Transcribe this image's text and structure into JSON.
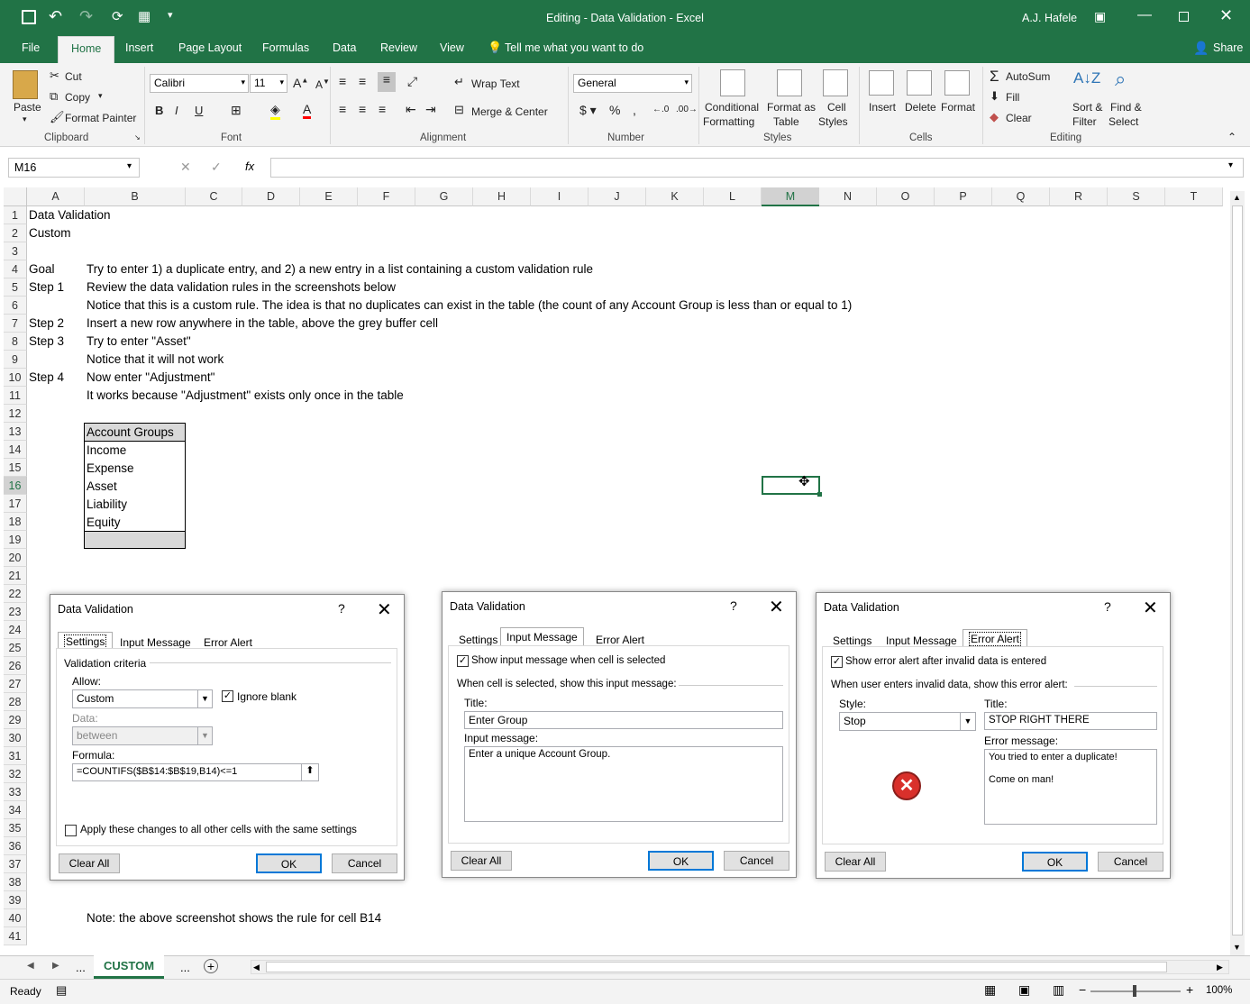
{
  "app": {
    "title": "Editing - Data Validation  -  Excel",
    "user": "A.J. Hafele",
    "accent": "#217346"
  },
  "menu": {
    "tabs": [
      "File",
      "Home",
      "Insert",
      "Page Layout",
      "Formulas",
      "Data",
      "Review",
      "View"
    ],
    "active": "Home",
    "tell_me": "Tell me what you want to do",
    "share": "Share"
  },
  "ribbon": {
    "clipboard": {
      "paste": "Paste",
      "cut": "Cut",
      "copy": "Copy",
      "format_painter": "Format Painter",
      "label": "Clipboard"
    },
    "font": {
      "name": "Calibri",
      "size": "11",
      "label": "Font"
    },
    "alignment": {
      "wrap": "Wrap Text",
      "merge": "Merge & Center",
      "label": "Alignment"
    },
    "number": {
      "format": "General",
      "label": "Number"
    },
    "styles": {
      "cond1": "Conditional",
      "cond2": "Formatting",
      "fmt1": "Format as",
      "fmt2": "Table",
      "cell1": "Cell",
      "cell2": "Styles",
      "label": "Styles"
    },
    "cells": {
      "insert": "Insert",
      "delete": "Delete",
      "format": "Format",
      "label": "Cells"
    },
    "editing": {
      "autosum": "AutoSum",
      "fill": "Fill",
      "clear": "Clear",
      "sort1": "Sort &",
      "sort2": "Filter",
      "find1": "Find &",
      "find2": "Select",
      "label": "Editing"
    }
  },
  "formula_bar": {
    "name_box": "M16",
    "formula": ""
  },
  "columns": [
    "A",
    "B",
    "C",
    "D",
    "E",
    "F",
    "G",
    "H",
    "I",
    "J",
    "K",
    "L",
    "M",
    "N",
    "O",
    "P",
    "Q",
    "R",
    "S",
    "T"
  ],
  "cells": {
    "a1": "Data Validation",
    "a2": "Custom",
    "a4": "Goal",
    "b4": "Try to enter 1) a duplicate entry, and 2) a new entry in a list containing a custom validation rule",
    "a5": "Step 1",
    "b5": "Review the data validation rules in the screenshots below",
    "b6": "Notice that this is a custom rule.  The idea is that no duplicates can exist in the table (the count of any Account Group is less than or equal to 1)",
    "a7": "Step 2",
    "b7": "Insert a new row anywhere in the table, above the grey buffer cell",
    "a8": "Step 3",
    "b8": "Try to enter \"Asset\"",
    "b9": "Notice that it will not work",
    "a10": "Step 4",
    "b10": "Now enter \"Adjustment\"",
    "b11": "It works because \"Adjustment\" exists only once in the table",
    "b40": "Note: the above screenshot shows the rule for cell B14"
  },
  "table": {
    "header": "Account Groups",
    "rows": [
      "Income",
      "Expense",
      "Asset",
      "Liability",
      "Equity"
    ]
  },
  "dialog_settings": {
    "title": "Data Validation",
    "tabs": [
      "Settings",
      "Input Message",
      "Error Alert"
    ],
    "criteria": "Validation criteria",
    "allow_label": "Allow:",
    "allow_value": "Custom",
    "ignore_blank": "Ignore blank",
    "data_label": "Data:",
    "data_value": "between",
    "formula_label": "Formula:",
    "formula_value": "=COUNTIFS($B$14:$B$19,B14)<=1",
    "apply_all": "Apply these changes to all other cells with the same settings",
    "clear": "Clear All",
    "ok": "OK",
    "cancel": "Cancel"
  },
  "dialog_input": {
    "title": "Data Validation",
    "tabs": [
      "Settings",
      "Input Message",
      "Error Alert"
    ],
    "show_msg": "Show input message when cell is selected",
    "when_selected": "When cell is selected, show this input message:",
    "title_label": "Title:",
    "title_value": "Enter Group",
    "msg_label": "Input message:",
    "msg_value": "Enter a unique Account Group.",
    "clear": "Clear All",
    "ok": "OK",
    "cancel": "Cancel"
  },
  "dialog_error": {
    "title": "Data Validation",
    "tabs": [
      "Settings",
      "Input Message",
      "Error Alert"
    ],
    "show_alert": "Show error alert after invalid data is entered",
    "when_invalid": "When user enters invalid data, show this error alert:",
    "style_label": "Style:",
    "style_value": "Stop",
    "title_label": "Title:",
    "title_value": "STOP RIGHT THERE",
    "msg_label": "Error message:",
    "msg_line1": "You tried to enter a duplicate!",
    "msg_line2": "Come on man!",
    "clear": "Clear All",
    "ok": "OK",
    "cancel": "Cancel"
  },
  "sheet_tabs": {
    "active": "CUSTOM",
    "ellipsis": "..."
  },
  "status": {
    "ready": "Ready",
    "zoom": "100%"
  }
}
